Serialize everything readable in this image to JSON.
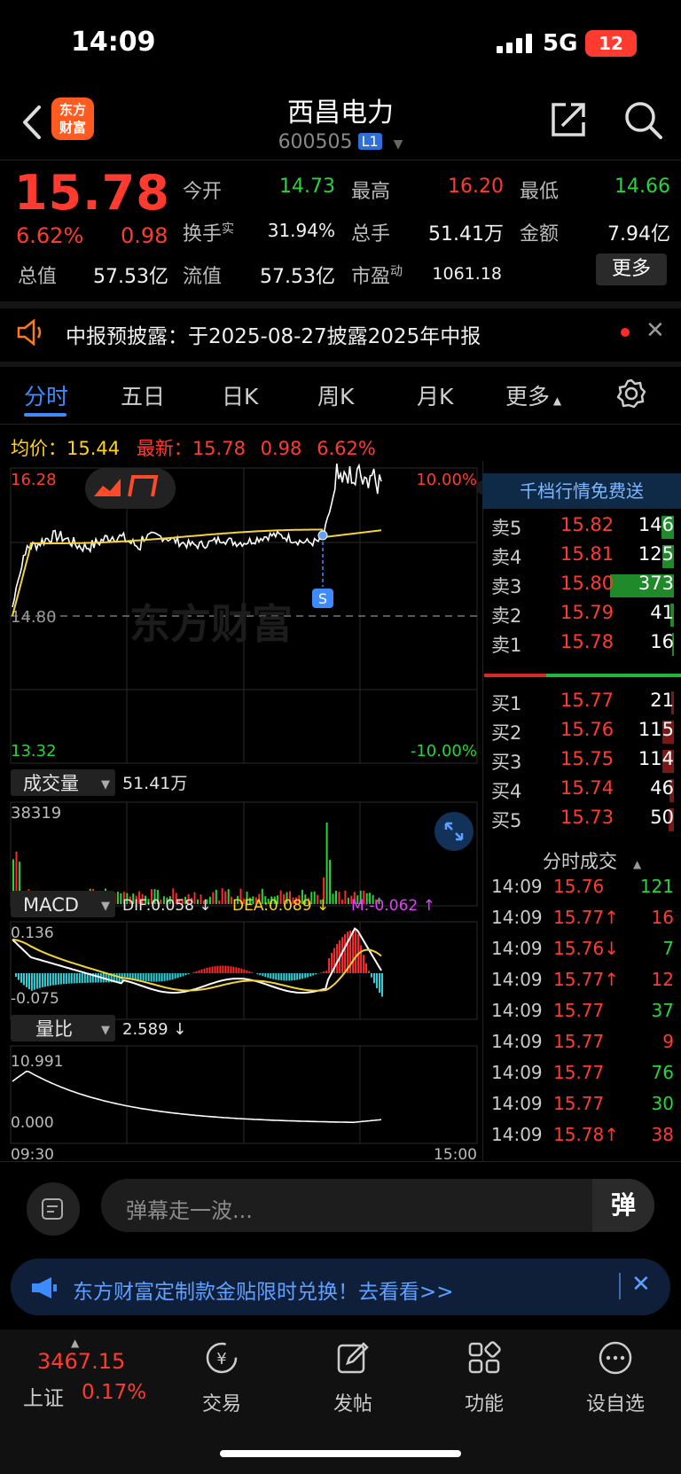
{
  "status_bar": {
    "time": "14:09",
    "network": "5G",
    "battery": "12"
  },
  "header": {
    "logo_text": "东方\n财富",
    "stock_name": "西昌电力",
    "stock_code": "600505",
    "level_badge": "L1"
  },
  "quote": {
    "price": "15.78",
    "change_pct": "6.62%",
    "change_amt": "0.98",
    "open_label": "今开",
    "open": "14.73",
    "high_label": "最高",
    "high": "16.20",
    "low_label": "最低",
    "low": "14.66",
    "turnover_label": "换手",
    "turnover_sup": "实",
    "turnover": "31.94%",
    "volume_label": "总手",
    "volume": "51.41万",
    "amount_label": "金额",
    "amount": "7.94亿",
    "total_cap_label": "总值",
    "total_cap": "57.53亿",
    "float_cap_label": "流值",
    "float_cap": "57.53亿",
    "pe_label": "市盈",
    "pe_sup": "动",
    "pe": "1061.18",
    "more_label": "更多"
  },
  "notice": {
    "text": "中报预披露：于2025-08-27披露2025年中报"
  },
  "tabs": [
    "分时",
    "五日",
    "日K",
    "周K",
    "月K",
    "更多"
  ],
  "avg_row": {
    "avg_label": "均价：",
    "avg": "15.44",
    "last_label": "最新：",
    "last": "15.78",
    "chg": "0.98",
    "pct": "6.62%"
  },
  "chart_data": {
    "type": "line",
    "price_axis": {
      "top": "16.28",
      "mid": "14.80",
      "bottom": "13.32",
      "top_pct": "10.00%",
      "bottom_pct": "-10.00%"
    },
    "volume": {
      "label": "成交量",
      "total": "51.41万",
      "max_label": "38319"
    },
    "macd": {
      "label": "MACD",
      "dif": "DIF:0.058 ↓",
      "dea": "DEA:0.089 ↓",
      "m": "M:-0.062 ↑",
      "top": "0.136",
      "bottom": "-0.075"
    },
    "ratio": {
      "label": "量比",
      "value": "2.589 ↓",
      "top": "10.991",
      "bottom": "0.000"
    },
    "time_start": "09:30",
    "time_end": "15:00",
    "marker": "S",
    "colors": {
      "price": "#ffffff",
      "avg": "#f5d43a",
      "up": "#ff2a2a",
      "down": "#25d63a"
    }
  },
  "order_book": {
    "banner": "千档行情免费送",
    "asks": [
      {
        "label": "卖5",
        "price": "15.82",
        "vol": "146",
        "bar": 0.2
      },
      {
        "label": "卖4",
        "price": "15.81",
        "vol": "125",
        "bar": 0.18
      },
      {
        "label": "卖3",
        "price": "15.80",
        "vol": "373",
        "bar": 1.0
      },
      {
        "label": "卖2",
        "price": "15.79",
        "vol": "41",
        "bar": 0.06
      },
      {
        "label": "卖1",
        "price": "15.78",
        "vol": "16",
        "bar": 0.03
      }
    ],
    "bids": [
      {
        "label": "买1",
        "price": "15.77",
        "vol": "21",
        "bar": 0.04
      },
      {
        "label": "买2",
        "price": "15.76",
        "vol": "115",
        "bar": 0.18
      },
      {
        "label": "买3",
        "price": "15.75",
        "vol": "114",
        "bar": 0.18
      },
      {
        "label": "买4",
        "price": "15.74",
        "vol": "46",
        "bar": 0.07
      },
      {
        "label": "买5",
        "price": "15.73",
        "vol": "50",
        "bar": 0.08
      }
    ],
    "ticks_title": "分时成交",
    "ticks": [
      {
        "time": "14:09",
        "price": "15.76",
        "vol": "121",
        "pc": "red",
        "vc": "green"
      },
      {
        "time": "14:09",
        "price": "15.77↑",
        "vol": "16",
        "pc": "red",
        "vc": "red"
      },
      {
        "time": "14:09",
        "price": "15.76↓",
        "vol": "7",
        "pc": "red",
        "vc": "green"
      },
      {
        "time": "14:09",
        "price": "15.77↑",
        "vol": "12",
        "pc": "red",
        "vc": "red"
      },
      {
        "time": "14:09",
        "price": "15.77",
        "vol": "37",
        "pc": "red",
        "vc": "green"
      },
      {
        "time": "14:09",
        "price": "15.77",
        "vol": "9",
        "pc": "red",
        "vc": "red"
      },
      {
        "time": "14:09",
        "price": "15.77",
        "vol": "76",
        "pc": "red",
        "vc": "green"
      },
      {
        "time": "14:09",
        "price": "15.77",
        "vol": "30",
        "pc": "red",
        "vc": "green"
      },
      {
        "time": "14:09",
        "price": "15.78↑",
        "vol": "38",
        "pc": "red",
        "vc": "red"
      }
    ]
  },
  "comment": {
    "placeholder": "弹幕走一波...",
    "button": "弹"
  },
  "ad": {
    "text": "东方财富定制款金贴限时兑换！去看看>>"
  },
  "index": {
    "value": "3467.15",
    "name": "上证",
    "pct": "0.17%"
  },
  "nav": [
    {
      "label": "交易",
      "icon": "yen-icon"
    },
    {
      "label": "发帖",
      "icon": "edit-icon"
    },
    {
      "label": "功能",
      "icon": "grid-icon"
    },
    {
      "label": "设自选",
      "icon": "more-icon"
    }
  ]
}
